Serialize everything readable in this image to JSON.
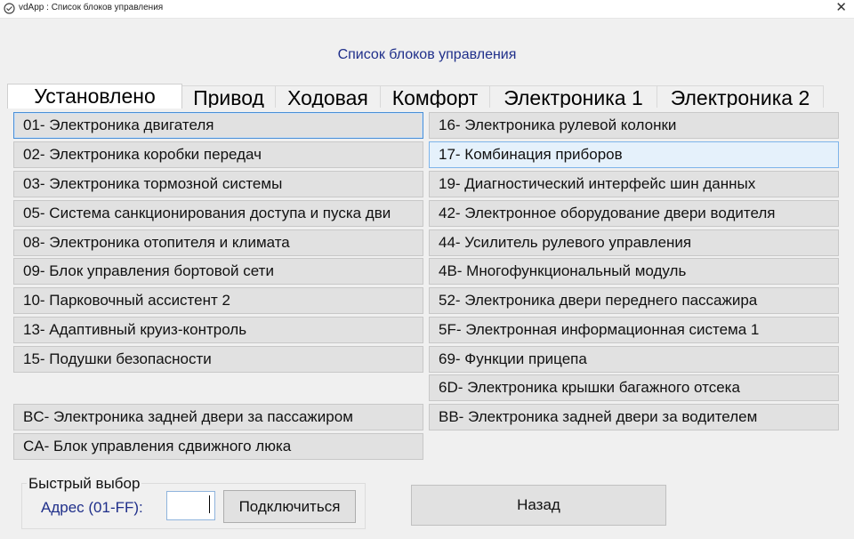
{
  "window": {
    "title": "vdApp :  Список блоков управления",
    "close_glyph": "✕"
  },
  "main": {
    "heading": "Список блоков управления"
  },
  "tabs": [
    {
      "label": "Установлено",
      "active": true
    },
    {
      "label": "Привод"
    },
    {
      "label": "Ходовая"
    },
    {
      "label": "Комфорт"
    },
    {
      "label": "Электроника 1"
    },
    {
      "label": "Электроника 2"
    }
  ],
  "left_modules": [
    {
      "label": "01- Электроника двигателя",
      "state": "focused"
    },
    {
      "label": "02- Электроника коробки передач"
    },
    {
      "label": "03- Электроника тормозной системы"
    },
    {
      "label": "05- Система санкционирования доступа и пуска дви"
    },
    {
      "label": "08- Электроника отопителя и климата"
    },
    {
      "label": "09- Блок управления бортовой сети"
    },
    {
      "label": "10- Парковочный ассистент 2"
    },
    {
      "label": "13- Адаптивный круиз-контроль"
    },
    {
      "label": "15- Подушки безопасности"
    },
    {
      "label": "BC- Электроника задней двери за пассажиром"
    },
    {
      "label": "CA- Блок управления сдвижного люка"
    }
  ],
  "right_modules": [
    {
      "label": "16- Электроника рулевой колонки"
    },
    {
      "label": "17- Комбинация приборов",
      "state": "hover"
    },
    {
      "label": "19- Диагностический интерфейс шин данных"
    },
    {
      "label": "42- Электронное оборудование двери водителя"
    },
    {
      "label": "44- Усилитель рулевого управления"
    },
    {
      "label": "4B- Многофункциональный модуль"
    },
    {
      "label": "52- Электроника двери переднего пассажира"
    },
    {
      "label": "5F- Электронная информационная система 1"
    },
    {
      "label": "69- Функции прицепа"
    },
    {
      "label": "6D- Электроника крышки багажного отсека"
    },
    {
      "label": "BB- Электроника задней двери за водителем"
    }
  ],
  "quick_select": {
    "group_label": "Быстрый выбор",
    "address_label": "Адрес (01-FF):",
    "address_value": "",
    "connect_label": "Подключиться"
  },
  "footer": {
    "back_label": "Назад"
  },
  "colors": {
    "heading": "#1f2f8a",
    "focus_border": "#4a8fd6",
    "hover_bg": "#e5f1fb"
  }
}
